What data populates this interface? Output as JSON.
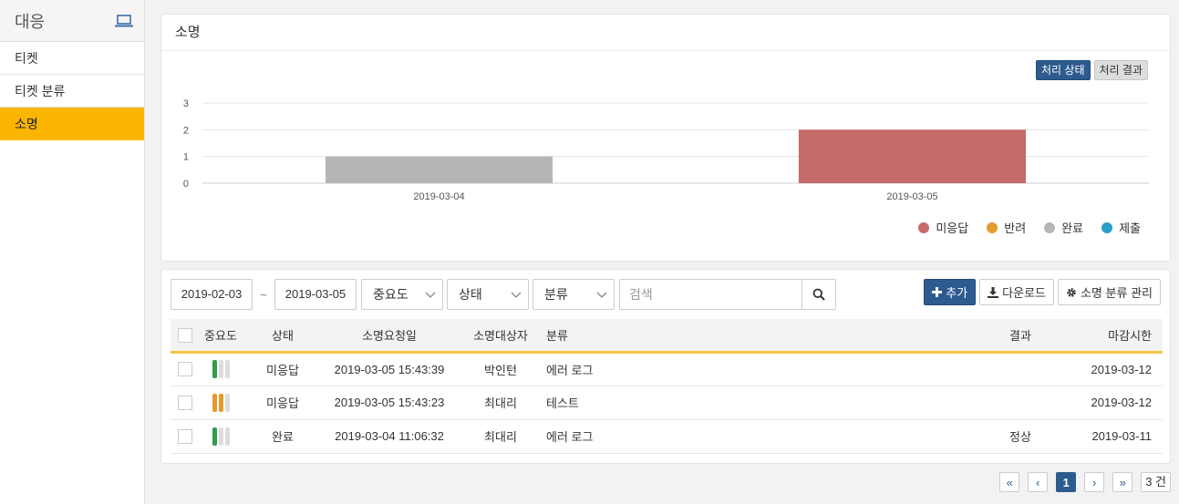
{
  "sidebar": {
    "title": "대응",
    "items": [
      {
        "label": "티켓"
      },
      {
        "label": "티켓 분류"
      },
      {
        "label": "소명"
      }
    ]
  },
  "chart_panel": {
    "title": "소명",
    "toggle": {
      "status_label": "처리 상태",
      "result_label": "처리 결과"
    }
  },
  "chart_data": {
    "type": "bar",
    "title": "",
    "xlabel": "",
    "ylabel": "",
    "ylim": [
      0,
      3
    ],
    "yticks": [
      "0",
      "1",
      "2",
      "3"
    ],
    "categories": [
      "2019-03-04",
      "2019-03-05"
    ],
    "series": [
      {
        "name": "미응답",
        "color": "#c66a6a",
        "values": [
          0,
          2
        ]
      },
      {
        "name": "반려",
        "color": "#e39b2c",
        "values": [
          0,
          0
        ]
      },
      {
        "name": "완료",
        "color": "#b5b5b5",
        "values": [
          1,
          0
        ]
      },
      {
        "name": "제출",
        "color": "#2a9fc9",
        "values": [
          0,
          0
        ]
      }
    ],
    "grid": true,
    "legend_position": "bottom-right"
  },
  "filters": {
    "date_from": "2019-02-03",
    "tilde": "~",
    "date_to": "2019-03-05",
    "priority": "중요도",
    "status": "상태",
    "category": "분류",
    "search_placeholder": "검색"
  },
  "actions": {
    "add": "추가",
    "download": "다운로드",
    "manage": "소명 분류 관리"
  },
  "table": {
    "headers": {
      "priority": "중요도",
      "status": "상태",
      "requested": "소명요청일",
      "target": "소명대상자",
      "category": "분류",
      "result": "결과",
      "deadline": "마감시한"
    },
    "rows": [
      {
        "priority_level": "low",
        "priority_color": "#2e9e4e",
        "status": "미응답",
        "requested": "2019-03-05 15:43:39",
        "target": "박인턴",
        "category": "에러 로그",
        "result": "",
        "deadline": "2019-03-12"
      },
      {
        "priority_level": "medium",
        "priority_color": "#e39b2c",
        "status": "미응답",
        "requested": "2019-03-05 15:43:23",
        "target": "최대리",
        "category": "테스트",
        "result": "",
        "deadline": "2019-03-12"
      },
      {
        "priority_level": "low",
        "priority_color": "#2e9e4e",
        "status": "완료",
        "requested": "2019-03-04 11:06:32",
        "target": "최대리",
        "category": "에러 로그",
        "result": "정상",
        "deadline": "2019-03-11"
      }
    ]
  },
  "pager": {
    "first": "«",
    "prev": "‹",
    "current": "1",
    "next": "›",
    "last": "»",
    "count": "3 건"
  }
}
